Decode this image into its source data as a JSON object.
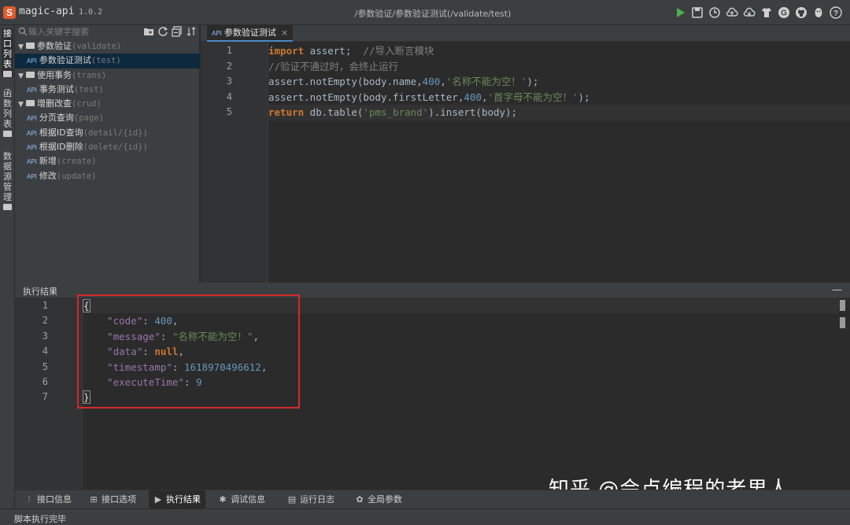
{
  "app": {
    "name": "magic-api",
    "version": "1.0.2",
    "logo": "S"
  },
  "titlebar": {
    "path": "/参数验证/参数验证测试(/validate/test)",
    "icons": [
      "run-icon",
      "save-icon",
      "history-icon",
      "upload-icon",
      "cloud-upload-icon",
      "skin-icon",
      "g-icon",
      "github-icon",
      "qq-icon",
      "help-icon"
    ]
  },
  "vstrip": {
    "tabs": [
      {
        "label": "接口列表",
        "active": true
      },
      {
        "label": "函数列表",
        "active": false
      },
      {
        "label": "数据源管理",
        "active": false
      }
    ]
  },
  "tree": {
    "search_placeholder": "输入关键字搜索",
    "api_badge": "API",
    "items": [
      {
        "type": "group",
        "name": "参数验证",
        "path": "(validate)"
      },
      {
        "type": "leaf",
        "name": "参数验证测试",
        "path": "(test)",
        "selected": true
      },
      {
        "type": "group",
        "name": "使用事务",
        "path": "(trans)"
      },
      {
        "type": "leaf",
        "name": "事务测试",
        "path": "(test)"
      },
      {
        "type": "group",
        "name": "增删改查",
        "path": "(crud)"
      },
      {
        "type": "leaf",
        "name": "分页查询",
        "path": "(page)"
      },
      {
        "type": "leaf",
        "name": "根据ID查询",
        "path": "(detail/{id})"
      },
      {
        "type": "leaf",
        "name": "根据ID删除",
        "path": "(delete/{id})"
      },
      {
        "type": "leaf",
        "name": "新增",
        "path": "(create)"
      },
      {
        "type": "leaf",
        "name": "修改",
        "path": "(update)"
      }
    ]
  },
  "editor": {
    "tab_label": "参数验证测试",
    "tab_close": "×",
    "lines": [
      {
        "n": "1",
        "tokens": [
          [
            "kw",
            "import"
          ],
          [
            "pl",
            " assert;  "
          ],
          [
            "cm",
            "//导入断言模块"
          ]
        ]
      },
      {
        "n": "2",
        "tokens": [
          [
            "cm",
            "//验证不通过时，会终止运行"
          ]
        ]
      },
      {
        "n": "3",
        "tokens": [
          [
            "pl",
            "assert.notEmpty(body.name,"
          ],
          [
            "num",
            "400"
          ],
          [
            "pl",
            ","
          ],
          [
            "str",
            "'名称不能为空！'"
          ],
          [
            "pl",
            ");"
          ]
        ]
      },
      {
        "n": "4",
        "tokens": [
          [
            "pl",
            "assert.notEmpty(body.firstLetter,"
          ],
          [
            "num",
            "400"
          ],
          [
            "pl",
            ","
          ],
          [
            "str",
            "'首字母不能为空！'"
          ],
          [
            "pl",
            ");"
          ]
        ]
      },
      {
        "n": "5",
        "tokens": [
          [
            "kw",
            "return"
          ],
          [
            "pl",
            " db.table("
          ],
          [
            "str",
            "'pms_brand'"
          ],
          [
            "pl",
            ").insert(body);"
          ]
        ],
        "current": true
      }
    ]
  },
  "results": {
    "title": "执行结果",
    "minimize": "—",
    "lines": [
      {
        "n": "1",
        "tokens": [
          [
            "brace",
            "{"
          ]
        ]
      },
      {
        "n": "2",
        "tokens": [
          [
            "pl",
            "    "
          ],
          [
            "jkey",
            "\"code\""
          ],
          [
            "pl",
            ": "
          ],
          [
            "jnum",
            "400"
          ],
          [
            "pl",
            ","
          ]
        ]
      },
      {
        "n": "3",
        "tokens": [
          [
            "pl",
            "    "
          ],
          [
            "jkey",
            "\"message\""
          ],
          [
            "pl",
            ": "
          ],
          [
            "jstr",
            "\"名称不能为空！\""
          ],
          [
            "pl",
            ","
          ]
        ]
      },
      {
        "n": "4",
        "tokens": [
          [
            "pl",
            "    "
          ],
          [
            "jkey",
            "\"data\""
          ],
          [
            "pl",
            ": "
          ],
          [
            "jkw",
            "null"
          ],
          [
            "pl",
            ","
          ]
        ]
      },
      {
        "n": "5",
        "tokens": [
          [
            "pl",
            "    "
          ],
          [
            "jkey",
            "\"timestamp\""
          ],
          [
            "pl",
            ": "
          ],
          [
            "jnum",
            "1618970496612"
          ],
          [
            "pl",
            ","
          ]
        ]
      },
      {
        "n": "6",
        "tokens": [
          [
            "pl",
            "    "
          ],
          [
            "jkey",
            "\"executeTime\""
          ],
          [
            "pl",
            ": "
          ],
          [
            "jnum",
            "9"
          ]
        ]
      },
      {
        "n": "7",
        "tokens": [
          [
            "brace",
            "}"
          ]
        ]
      }
    ]
  },
  "watermark": "知乎 @会点编程的老男人",
  "bottom_tabs": [
    {
      "label": "接口信息",
      "icon": "info-icon",
      "glyph": "⫶"
    },
    {
      "label": "接口选项",
      "icon": "options-icon",
      "glyph": "⊞"
    },
    {
      "label": "执行结果",
      "icon": "play-icon",
      "glyph": "▶",
      "active": true
    },
    {
      "label": "调试信息",
      "icon": "debug-icon",
      "glyph": "✱"
    },
    {
      "label": "运行日志",
      "icon": "log-icon",
      "glyph": "▤"
    },
    {
      "label": "全局参数",
      "icon": "gear-icon",
      "glyph": "✿"
    }
  ],
  "status": {
    "text": "脚本执行完毕"
  },
  "colors": {
    "accent": "#4a88c7",
    "highlight": "#d42a2a",
    "run": "#4caf50"
  }
}
